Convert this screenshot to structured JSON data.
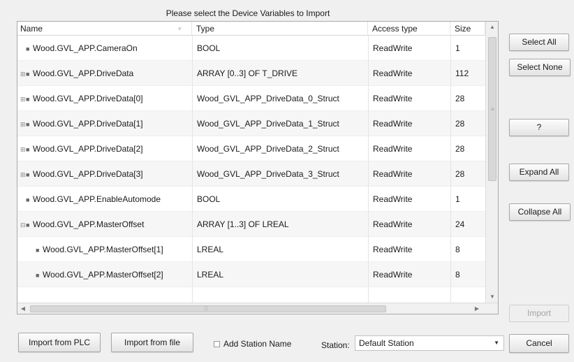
{
  "title": "Please select the Device Variables to Import",
  "columns": {
    "name": "Name",
    "type": "Type",
    "access": "Access type",
    "size": "Size"
  },
  "rows": [
    {
      "name": "Wood.GVL_APP.CameraOn",
      "type": "BOOL",
      "access": "ReadWrite",
      "size": "1",
      "expandable": false,
      "level": 0
    },
    {
      "name": "Wood.GVL_APP.DriveData",
      "type": "ARRAY [0..3] OF T_DRIVE",
      "access": "ReadWrite",
      "size": "112",
      "expandable": true,
      "level": 0
    },
    {
      "name": "Wood.GVL_APP.DriveData[0]",
      "type": "Wood_GVL_APP_DriveData_0_Struct",
      "access": "ReadWrite",
      "size": "28",
      "expandable": true,
      "level": 0
    },
    {
      "name": "Wood.GVL_APP.DriveData[1]",
      "type": "Wood_GVL_APP_DriveData_1_Struct",
      "access": "ReadWrite",
      "size": "28",
      "expandable": true,
      "level": 0
    },
    {
      "name": "Wood.GVL_APP.DriveData[2]",
      "type": "Wood_GVL_APP_DriveData_2_Struct",
      "access": "ReadWrite",
      "size": "28",
      "expandable": true,
      "level": 0
    },
    {
      "name": "Wood.GVL_APP.DriveData[3]",
      "type": "Wood_GVL_APP_DriveData_3_Struct",
      "access": "ReadWrite",
      "size": "28",
      "expandable": true,
      "level": 0
    },
    {
      "name": "Wood.GVL_APP.EnableAutomode",
      "type": "BOOL",
      "access": "ReadWrite",
      "size": "1",
      "expandable": false,
      "level": 0
    },
    {
      "name": "Wood.GVL_APP.MasterOffset",
      "type": "ARRAY [1..3] OF LREAL",
      "access": "ReadWrite",
      "size": "24",
      "expandable": true,
      "expanded": true,
      "level": 0
    },
    {
      "name": "Wood.GVL_APP.MasterOffset[1]",
      "type": "LREAL",
      "access": "ReadWrite",
      "size": "8",
      "expandable": false,
      "level": 1
    },
    {
      "name": "Wood.GVL_APP.MasterOffset[2]",
      "type": "LREAL",
      "access": "ReadWrite",
      "size": "8",
      "expandable": false,
      "level": 1
    },
    {
      "name": "",
      "type": "",
      "access": "",
      "size": "",
      "expandable": false,
      "level": 1
    }
  ],
  "buttons": {
    "select_all": "Select All",
    "select_none": "Select None",
    "help": "?",
    "expand_all": "Expand All",
    "collapse_all": "Collapse All",
    "import": "Import",
    "cancel": "Cancel",
    "import_from_plc": "Import from PLC",
    "import_from_file": "Import from file"
  },
  "add_station_name": {
    "label": "Add Station Name",
    "checked": false
  },
  "station": {
    "label": "Station:",
    "value": "Default Station"
  },
  "icons": {
    "expand": "plus-box-icon",
    "collapse": "minus-box-icon",
    "variable": "variable-node-icon",
    "sort": "sort-indicator-icon",
    "dropdown": "chevron-down-icon"
  },
  "colors": {
    "background": "#f0f0f0",
    "grid": "#ffffff",
    "alt_row": "#f6f6f6",
    "disabled_text": "#a3a3a3"
  }
}
